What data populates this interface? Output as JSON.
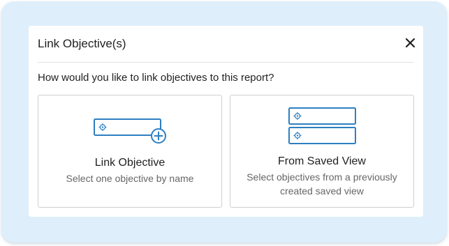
{
  "dialog": {
    "title": "Link Objective(s)",
    "close_icon": "close-icon",
    "prompt": "How would you like to link objectives to this report?"
  },
  "options": [
    {
      "icon": "link-objective-icon",
      "title": "Link Objective",
      "description": "Select one objective by name"
    },
    {
      "icon": "saved-view-icon",
      "title": "From Saved View",
      "description": "Select objectives from a previously created saved view"
    }
  ],
  "colors": {
    "accent": "#2d7fc1",
    "backdrop": "#deeefa",
    "border": "#cfcfcf",
    "text": "#1f1f1f",
    "muted_text": "#666666"
  }
}
